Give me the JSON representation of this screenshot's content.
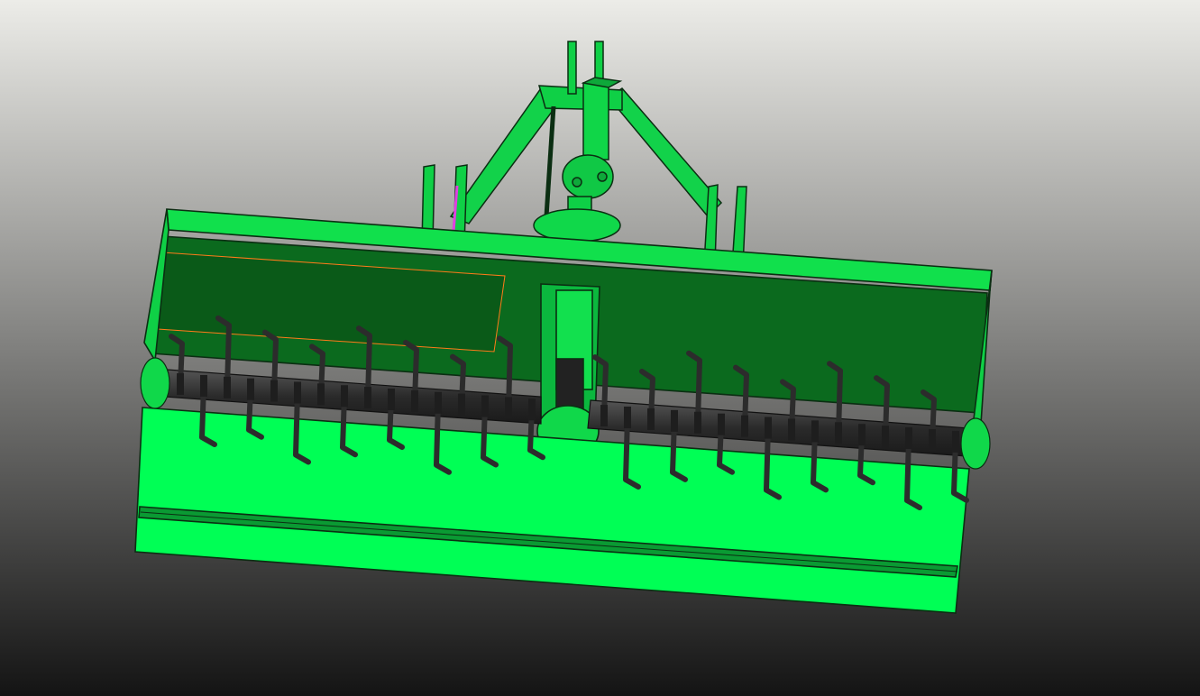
{
  "viewport": {
    "background_top": "#ecece8",
    "background_bottom": "#141414"
  },
  "model": {
    "colors": {
      "body_bright": "#00ff55",
      "body_mid": "#0bd845",
      "body_dark": "#0a6a1c",
      "edge": "#0b2e12",
      "shaft": "#3a3a3a",
      "blade": "#2c2c2c",
      "highlight_magenta": "#e040e0",
      "highlight_orange": "#ff7a1a"
    },
    "icons": [
      "rotary-tiller-model"
    ]
  }
}
